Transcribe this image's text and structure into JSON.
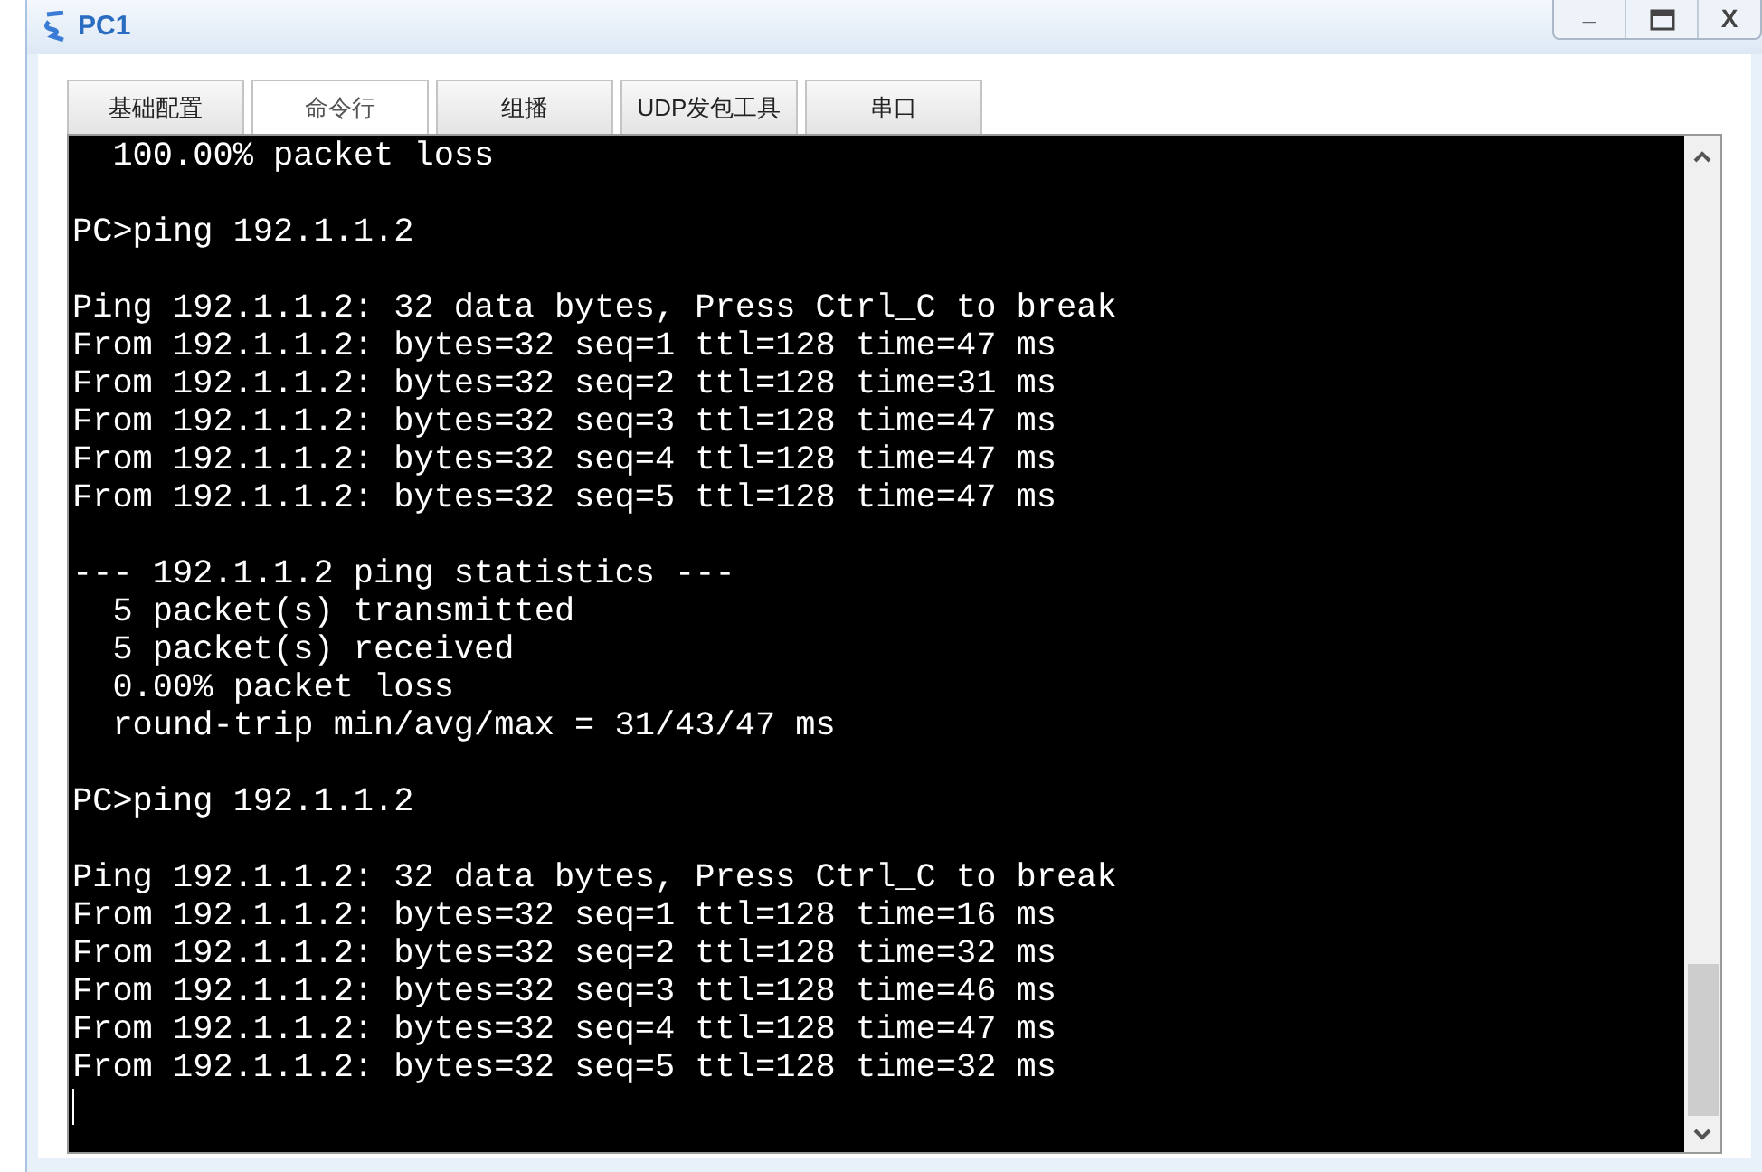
{
  "window": {
    "title": "PC1",
    "controls": [
      "_",
      "X"
    ]
  },
  "tabs": [
    {
      "label": "基础配置",
      "selected": false
    },
    {
      "label": "命令行",
      "selected": true
    },
    {
      "label": "组播",
      "selected": false
    },
    {
      "label": "UDP发包工具",
      "selected": false
    },
    {
      "label": "串口",
      "selected": false
    }
  ],
  "terminal": {
    "blocks": [
      [
        "  100.00% packet loss"
      ],
      [
        "PC>ping 192.1.1.2"
      ],
      [
        "Ping 192.1.1.2: 32 data bytes, Press Ctrl_C to break",
        "From 192.1.1.2: bytes=32 seq=1 ttl=128 time=47 ms",
        "From 192.1.1.2: bytes=32 seq=2 ttl=128 time=31 ms",
        "From 192.1.1.2: bytes=32 seq=3 ttl=128 time=47 ms",
        "From 192.1.1.2: bytes=32 seq=4 ttl=128 time=47 ms",
        "From 192.1.1.2: bytes=32 seq=5 ttl=128 time=47 ms"
      ],
      [
        "--- 192.1.1.2 ping statistics ---",
        "  5 packet(s) transmitted",
        "  5 packet(s) received",
        "  0.00% packet loss",
        "  round-trip min/avg/max = 31/43/47 ms"
      ],
      [
        "PC>ping 192.1.1.2"
      ],
      [
        "Ping 192.1.1.2: 32 data bytes, Press Ctrl_C to break",
        "From 192.1.1.2: bytes=32 seq=1 ttl=128 time=16 ms",
        "From 192.1.1.2: bytes=32 seq=2 ttl=128 time=32 ms",
        "From 192.1.1.2: bytes=32 seq=3 ttl=128 time=46 ms",
        "From 192.1.1.2: bytes=32 seq=4 ttl=128 time=47 ms",
        "From 192.1.1.2: bytes=32 seq=5 ttl=128 time=32 ms"
      ]
    ]
  }
}
